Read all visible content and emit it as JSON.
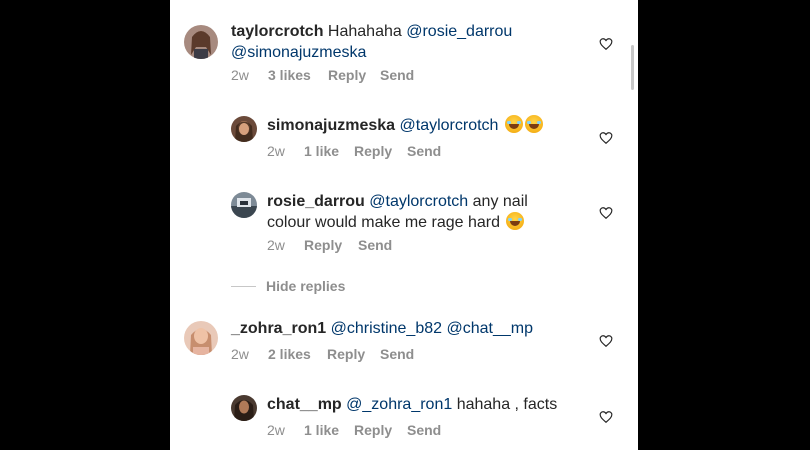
{
  "comments": [
    {
      "username": "taylorcrotch",
      "text_plain": "Hahahaha",
      "mention1": "@rosie_darrou",
      "mention2": "@simonajuzmeska",
      "time": "2w",
      "likes": "3 likes",
      "reply": "Reply",
      "send": "Send"
    },
    {
      "username": "simonajuzmeska",
      "mention1": "@taylorcrotch",
      "emoji": "laughing-tears-emoji",
      "time": "2w",
      "likes": "1 like",
      "reply": "Reply",
      "send": "Send"
    },
    {
      "username": "rosie_darrou",
      "mention1": "@taylorcrotch",
      "text_line1": "any nail",
      "text_line2": "colour would make me rage hard",
      "emoji": "laughing-tears-emoji",
      "time": "2w",
      "reply": "Reply",
      "send": "Send"
    },
    {
      "username": "_zohra_ron1",
      "mention1": "@christine_b82",
      "mention2": "@chat__mp",
      "time": "2w",
      "likes": "2 likes",
      "reply": "Reply",
      "send": "Send"
    },
    {
      "username": "chat__mp",
      "mention1": "@_zohra_ron1",
      "text_plain": "hahaha , facts",
      "time": "2w",
      "likes": "1 like",
      "reply": "Reply",
      "send": "Send"
    }
  ],
  "hide_replies": "Hide replies",
  "colors": {
    "mention": "#00376b",
    "meta": "#8e8e8e",
    "text": "#262626"
  }
}
